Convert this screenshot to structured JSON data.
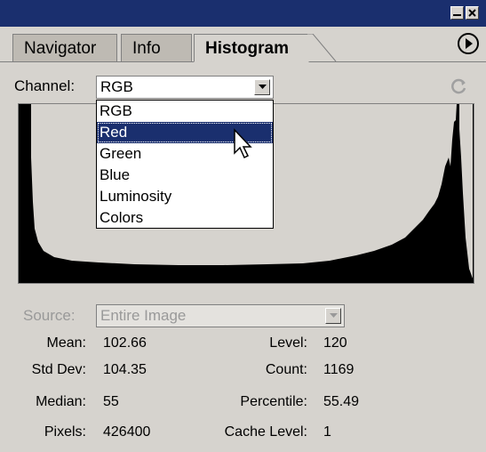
{
  "window": {
    "minimize_icon": "minimize-icon",
    "close_icon": "close-icon"
  },
  "tabs": [
    {
      "label": "Navigator",
      "active": false
    },
    {
      "label": "Info",
      "active": false
    },
    {
      "label": "Histogram",
      "active": true
    }
  ],
  "channel": {
    "label": "Channel:",
    "value": "RGB",
    "options": [
      "RGB",
      "Red",
      "Green",
      "Blue",
      "Luminosity",
      "Colors"
    ],
    "highlighted": "Red"
  },
  "source": {
    "label": "Source:",
    "value": "Entire Image"
  },
  "stats": {
    "mean_label": "Mean:",
    "mean": "102.66",
    "stddev_label": "Std Dev:",
    "stddev": "104.35",
    "median_label": "Median:",
    "median": "55",
    "pixels_label": "Pixels:",
    "pixels": "426400",
    "level_label": "Level:",
    "level": "120",
    "count_label": "Count:",
    "count": "1169",
    "percentile_label": "Percentile:",
    "percentile": "55.49",
    "cache_label": "Cache Level:",
    "cache": "1"
  },
  "colors": {
    "titlebar": "#1a2f6e",
    "panel": "#d6d3ce",
    "histogram_bg": "#d6d3ce",
    "histogram_fill": "#000000"
  }
}
